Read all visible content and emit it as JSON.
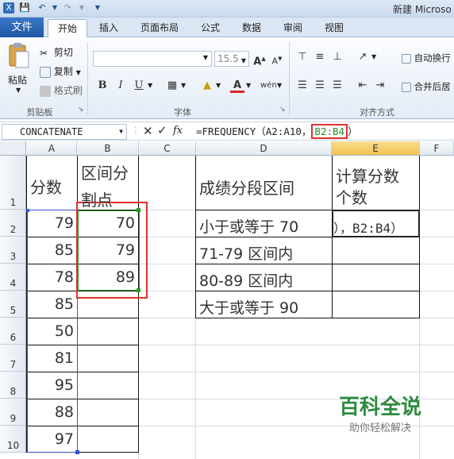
{
  "window": {
    "title": "新建 Microso"
  },
  "tabs": [
    "文件",
    "开始",
    "插入",
    "页面布局",
    "公式",
    "数据",
    "审阅",
    "视图"
  ],
  "clipboard": {
    "paste": "粘贴",
    "cut": "剪切",
    "copy": "复制",
    "format_painter": "格式刷",
    "label": "剪贴板"
  },
  "font": {
    "size": "15.5",
    "label": "字体",
    "bold": "B",
    "italic": "I",
    "underline": "U"
  },
  "alignment": {
    "wrap": "自动换行",
    "merge": "合并后居",
    "label": "对齐方式"
  },
  "formula_bar": {
    "name_box": "CONCATENATE",
    "fx": "fx",
    "formula_prefix": "=FREQUENCY（A2:A10，",
    "formula_highlight": "B2:B4",
    "formula_suffix": "）"
  },
  "columns": [
    "A",
    "B",
    "C",
    "D",
    "E",
    "F"
  ],
  "rows": [
    "1",
    "2",
    "3",
    "4",
    "5",
    "6",
    "7",
    "8",
    "9",
    "10"
  ],
  "sheet": {
    "a1": "分数",
    "b1_line1": "区间分",
    "b1_line2": "割点",
    "a_values": [
      "79",
      "85",
      "78",
      "85",
      "50",
      "81",
      "95",
      "88",
      "97"
    ],
    "b_values": [
      "70",
      "79",
      "89"
    ],
    "d1": "成绩分段区间",
    "e1_line1": "计算分数",
    "e1_line2": "个数",
    "d_values": [
      "小于或等于 70",
      "71-79 区间内",
      "80-89 区间内",
      "大于或等于 90"
    ],
    "e2": "），B2:B4）"
  },
  "watermark": {
    "title": "百科全说",
    "subtitle": "助你轻松解决"
  },
  "colors": {
    "accent": "#1f56a3",
    "highlight": "#e03030",
    "watermark": "#2e8b3e"
  }
}
